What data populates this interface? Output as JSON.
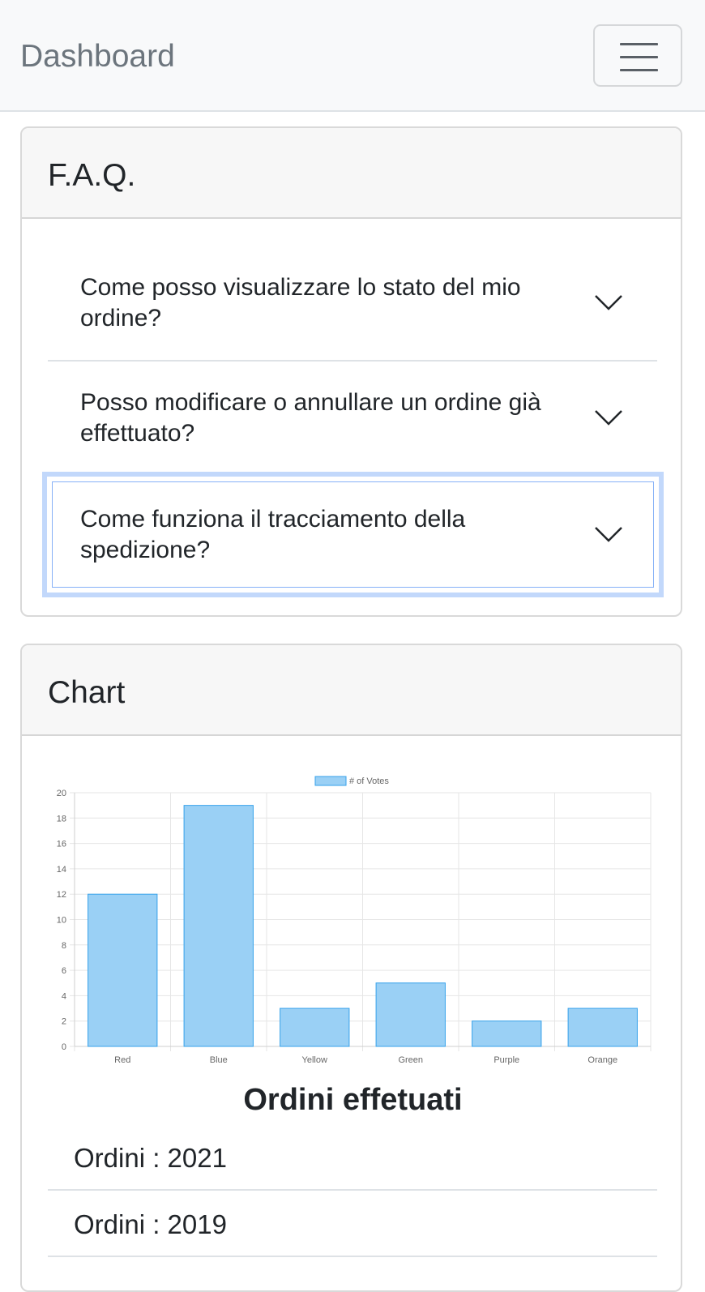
{
  "navbar": {
    "brand": "Dashboard",
    "toggle_icon": "hamburger-menu-icon"
  },
  "faq": {
    "title": "F.A.Q.",
    "items": [
      {
        "question_line1": "Come posso visualizzare lo stato del mio",
        "question_line2": "ordine?",
        "icon": "chevron-down-icon"
      },
      {
        "question_line1": "Posso modificare o annullare un ordine già",
        "question_line2": "effettuato?",
        "icon": "chevron-down-icon"
      },
      {
        "question_line1": "Come funziona il tracciamento della",
        "question_line2": "spedizione?",
        "icon": "chevron-down-icon",
        "focused": true
      }
    ]
  },
  "chart_card": {
    "title": "Chart",
    "chart_data": {
      "type": "bar",
      "categories": [
        "Red",
        "Blue",
        "Yellow",
        "Green",
        "Purple",
        "Orange"
      ],
      "series": [
        {
          "name": "# of Votes",
          "values": [
            12,
            19,
            3,
            5,
            2,
            3
          ]
        }
      ],
      "ylim": [
        0,
        20
      ],
      "yticks": [
        "0",
        "2",
        "4",
        "6",
        "8",
        "10",
        "12",
        "14",
        "16",
        "18",
        "20"
      ],
      "grid": true,
      "legend": "top-center",
      "bar_color": "#9ad0f5",
      "bar_border": "#36a2eb"
    },
    "orders_title": "Ordini effetuati",
    "orders": [
      "Ordini : 2021",
      "Ordini : 2019"
    ]
  }
}
